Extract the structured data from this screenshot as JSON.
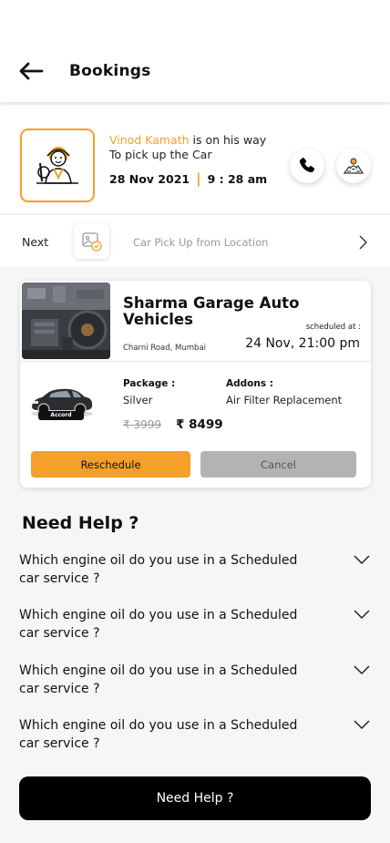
{
  "header": {
    "title": "Bookings",
    "back_icon": "arrow-left-icon"
  },
  "status": {
    "driver_name": "Vinod Kamath",
    "message_tail": " is on his way To pick up the Car",
    "date": "28 Nov 2021",
    "separator": "|",
    "time": "9 : 28 am",
    "call_icon": "phone-icon",
    "map_icon": "map-person-icon"
  },
  "next": {
    "label": "Next",
    "task": "Car Pick Up from Location",
    "icon": "image-check-icon"
  },
  "booking": {
    "garage_name": "Sharma Garage Auto Vehicles",
    "location": "Charni Road, Mumbai",
    "scheduled_label": "scheduled at :",
    "scheduled_value": "24 Nov, 21:00 pm",
    "car_name": "Accord",
    "package_label": "Package :",
    "package_value": "Silver",
    "addons_label": "Addons :",
    "addons_value": "Air Filter Replacement",
    "old_price": "₹ 3999",
    "new_price": "₹ 8499",
    "reschedule_label": "Reschedule",
    "cancel_label": "Cancel"
  },
  "help": {
    "title": "Need Help ?",
    "faqs": [
      {
        "question": "Which engine oil do you use in a Scheduled car service ?"
      },
      {
        "question": "Which engine oil do you use in a Scheduled car service ?"
      },
      {
        "question": "Which engine oil do you use in a Scheduled car service ?"
      },
      {
        "question": "Which engine oil do you use in a Scheduled car service ?"
      }
    ],
    "button_label": "Need Help ?"
  },
  "colors": {
    "accent": "#f5a02a",
    "cancel": "#b3b3b3",
    "primary_button": "#000000"
  }
}
